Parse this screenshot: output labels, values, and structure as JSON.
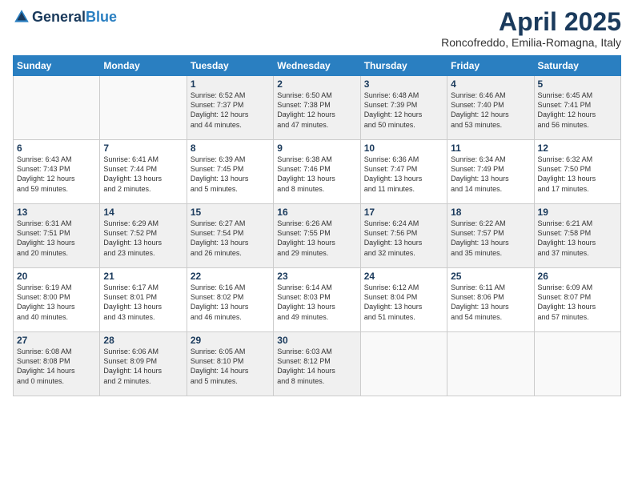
{
  "header": {
    "logo_general": "General",
    "logo_blue": "Blue",
    "title": "April 2025",
    "subtitle": "Roncofreddo, Emilia-Romagna, Italy"
  },
  "days_of_week": [
    "Sunday",
    "Monday",
    "Tuesday",
    "Wednesday",
    "Thursday",
    "Friday",
    "Saturday"
  ],
  "weeks": [
    [
      {
        "day": "",
        "info": ""
      },
      {
        "day": "",
        "info": ""
      },
      {
        "day": "1",
        "info": "Sunrise: 6:52 AM\nSunset: 7:37 PM\nDaylight: 12 hours\nand 44 minutes."
      },
      {
        "day": "2",
        "info": "Sunrise: 6:50 AM\nSunset: 7:38 PM\nDaylight: 12 hours\nand 47 minutes."
      },
      {
        "day": "3",
        "info": "Sunrise: 6:48 AM\nSunset: 7:39 PM\nDaylight: 12 hours\nand 50 minutes."
      },
      {
        "day": "4",
        "info": "Sunrise: 6:46 AM\nSunset: 7:40 PM\nDaylight: 12 hours\nand 53 minutes."
      },
      {
        "day": "5",
        "info": "Sunrise: 6:45 AM\nSunset: 7:41 PM\nDaylight: 12 hours\nand 56 minutes."
      }
    ],
    [
      {
        "day": "6",
        "info": "Sunrise: 6:43 AM\nSunset: 7:43 PM\nDaylight: 12 hours\nand 59 minutes."
      },
      {
        "day": "7",
        "info": "Sunrise: 6:41 AM\nSunset: 7:44 PM\nDaylight: 13 hours\nand 2 minutes."
      },
      {
        "day": "8",
        "info": "Sunrise: 6:39 AM\nSunset: 7:45 PM\nDaylight: 13 hours\nand 5 minutes."
      },
      {
        "day": "9",
        "info": "Sunrise: 6:38 AM\nSunset: 7:46 PM\nDaylight: 13 hours\nand 8 minutes."
      },
      {
        "day": "10",
        "info": "Sunrise: 6:36 AM\nSunset: 7:47 PM\nDaylight: 13 hours\nand 11 minutes."
      },
      {
        "day": "11",
        "info": "Sunrise: 6:34 AM\nSunset: 7:49 PM\nDaylight: 13 hours\nand 14 minutes."
      },
      {
        "day": "12",
        "info": "Sunrise: 6:32 AM\nSunset: 7:50 PM\nDaylight: 13 hours\nand 17 minutes."
      }
    ],
    [
      {
        "day": "13",
        "info": "Sunrise: 6:31 AM\nSunset: 7:51 PM\nDaylight: 13 hours\nand 20 minutes."
      },
      {
        "day": "14",
        "info": "Sunrise: 6:29 AM\nSunset: 7:52 PM\nDaylight: 13 hours\nand 23 minutes."
      },
      {
        "day": "15",
        "info": "Sunrise: 6:27 AM\nSunset: 7:54 PM\nDaylight: 13 hours\nand 26 minutes."
      },
      {
        "day": "16",
        "info": "Sunrise: 6:26 AM\nSunset: 7:55 PM\nDaylight: 13 hours\nand 29 minutes."
      },
      {
        "day": "17",
        "info": "Sunrise: 6:24 AM\nSunset: 7:56 PM\nDaylight: 13 hours\nand 32 minutes."
      },
      {
        "day": "18",
        "info": "Sunrise: 6:22 AM\nSunset: 7:57 PM\nDaylight: 13 hours\nand 35 minutes."
      },
      {
        "day": "19",
        "info": "Sunrise: 6:21 AM\nSunset: 7:58 PM\nDaylight: 13 hours\nand 37 minutes."
      }
    ],
    [
      {
        "day": "20",
        "info": "Sunrise: 6:19 AM\nSunset: 8:00 PM\nDaylight: 13 hours\nand 40 minutes."
      },
      {
        "day": "21",
        "info": "Sunrise: 6:17 AM\nSunset: 8:01 PM\nDaylight: 13 hours\nand 43 minutes."
      },
      {
        "day": "22",
        "info": "Sunrise: 6:16 AM\nSunset: 8:02 PM\nDaylight: 13 hours\nand 46 minutes."
      },
      {
        "day": "23",
        "info": "Sunrise: 6:14 AM\nSunset: 8:03 PM\nDaylight: 13 hours\nand 49 minutes."
      },
      {
        "day": "24",
        "info": "Sunrise: 6:12 AM\nSunset: 8:04 PM\nDaylight: 13 hours\nand 51 minutes."
      },
      {
        "day": "25",
        "info": "Sunrise: 6:11 AM\nSunset: 8:06 PM\nDaylight: 13 hours\nand 54 minutes."
      },
      {
        "day": "26",
        "info": "Sunrise: 6:09 AM\nSunset: 8:07 PM\nDaylight: 13 hours\nand 57 minutes."
      }
    ],
    [
      {
        "day": "27",
        "info": "Sunrise: 6:08 AM\nSunset: 8:08 PM\nDaylight: 14 hours\nand 0 minutes."
      },
      {
        "day": "28",
        "info": "Sunrise: 6:06 AM\nSunset: 8:09 PM\nDaylight: 14 hours\nand 2 minutes."
      },
      {
        "day": "29",
        "info": "Sunrise: 6:05 AM\nSunset: 8:10 PM\nDaylight: 14 hours\nand 5 minutes."
      },
      {
        "day": "30",
        "info": "Sunrise: 6:03 AM\nSunset: 8:12 PM\nDaylight: 14 hours\nand 8 minutes."
      },
      {
        "day": "",
        "info": ""
      },
      {
        "day": "",
        "info": ""
      },
      {
        "day": "",
        "info": ""
      }
    ]
  ]
}
